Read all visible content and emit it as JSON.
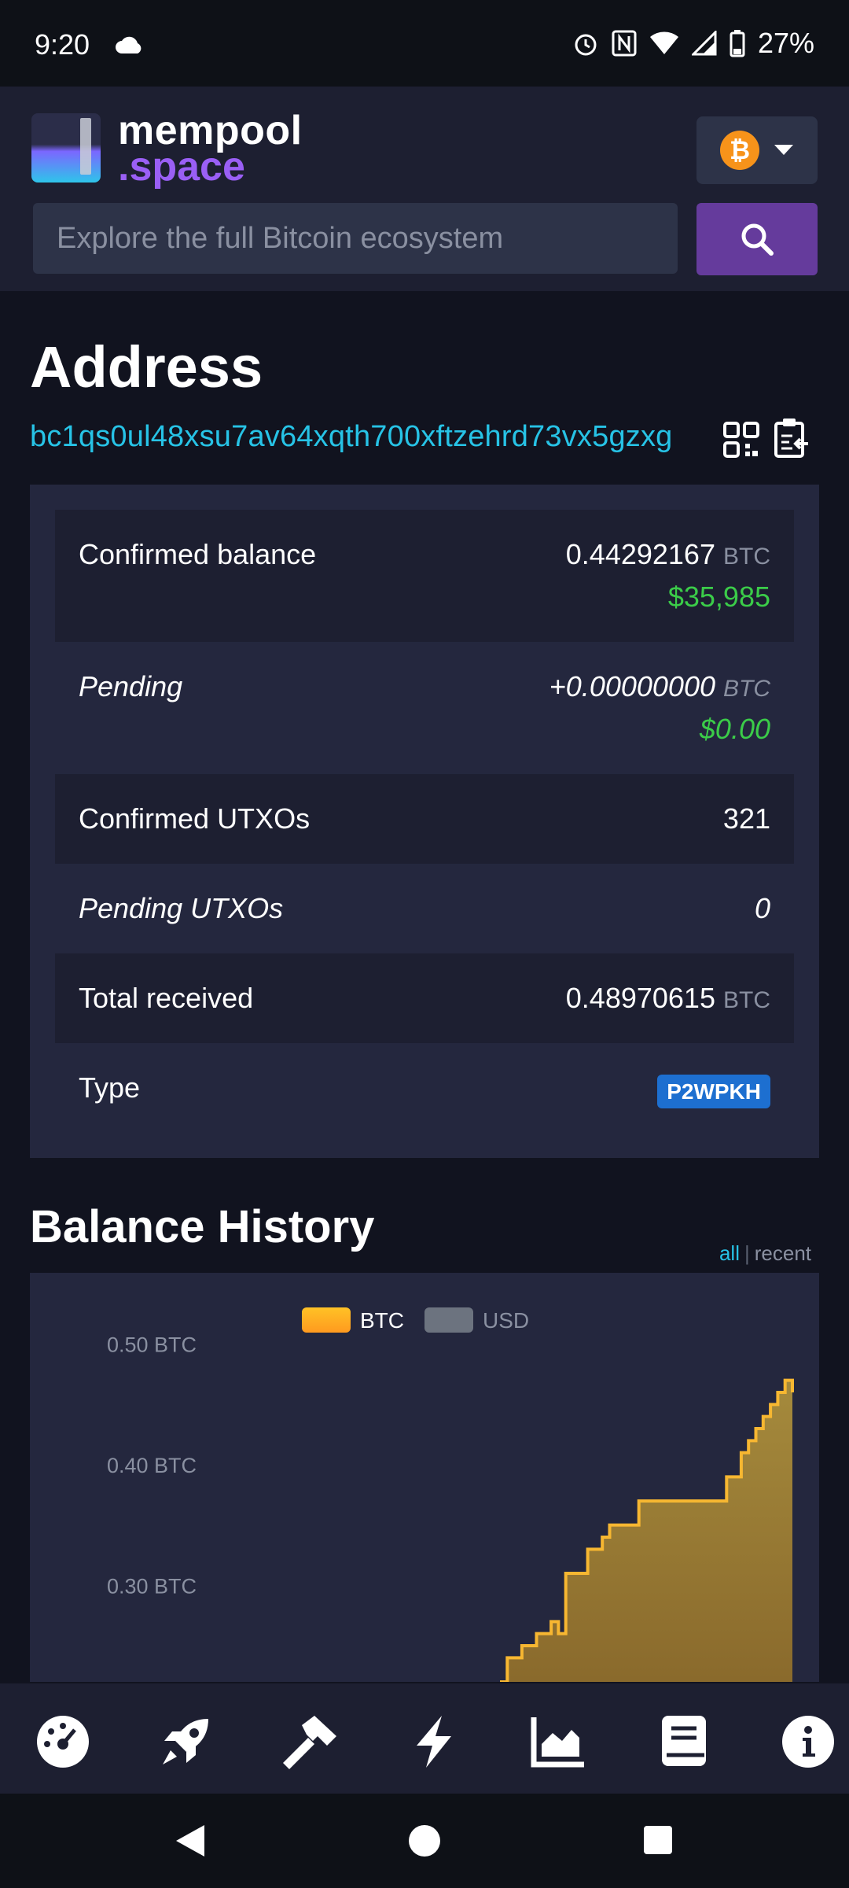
{
  "status_bar": {
    "time": "9:20",
    "battery": "27%"
  },
  "header": {
    "logo_line1": "mempool",
    "logo_line2": ".space",
    "search_placeholder": "Explore the full Bitcoin ecosystem",
    "network": "bitcoin"
  },
  "address_page": {
    "title": "Address",
    "address": "bc1qs0ul48xsu7av64xqth700xftzehrd73vx5gzxg",
    "rows": [
      {
        "label": "Confirmed balance",
        "value": "0.44292167",
        "unit": "BTC",
        "fiat": "$35,985"
      },
      {
        "label": "Pending",
        "value": "+0.00000000",
        "unit": "BTC",
        "fiat": "$0.00"
      },
      {
        "label": "Confirmed UTXOs",
        "value": "321"
      },
      {
        "label": "Pending UTXOs",
        "value": "0"
      },
      {
        "label": "Total received",
        "value": "0.48970615",
        "unit": "BTC"
      },
      {
        "label": "Type",
        "value": "P2WPKH"
      }
    ]
  },
  "balance_history": {
    "title": "Balance History",
    "toggle_all": "all",
    "toggle_sep": "|",
    "toggle_recent": "recent"
  },
  "chart_data": {
    "type": "area",
    "title": "",
    "legend": [
      "BTC",
      "USD"
    ],
    "legend_position": "top-center",
    "y_ticks": [
      "0.50 BTC",
      "0.40 BTC",
      "0.30 BTC"
    ],
    "ylim_visible": [
      0.22,
      0.52
    ],
    "series": [
      {
        "name": "BTC",
        "color": "#f7b731",
        "x_fraction": [
          0.6,
          0.61,
          0.63,
          0.65,
          0.67,
          0.68,
          0.69,
          0.72,
          0.74,
          0.75,
          0.79,
          0.8,
          0.9,
          0.91,
          0.93,
          0.94,
          0.95,
          0.96,
          0.97,
          0.98,
          0.99,
          1.0
        ],
        "values": [
          0.22,
          0.24,
          0.25,
          0.26,
          0.27,
          0.26,
          0.31,
          0.33,
          0.34,
          0.35,
          0.37,
          0.37,
          0.37,
          0.39,
          0.41,
          0.42,
          0.43,
          0.44,
          0.45,
          0.46,
          0.47,
          0.46
        ]
      }
    ],
    "colors": {
      "BTC": "#f7b731",
      "USD": "#6c737f"
    }
  },
  "bottom_nav": {
    "items": [
      "dashboard-icon",
      "rocket-icon",
      "hammer-icon",
      "lightning-icon",
      "chart-icon",
      "docs-icon",
      "info-icon"
    ]
  }
}
